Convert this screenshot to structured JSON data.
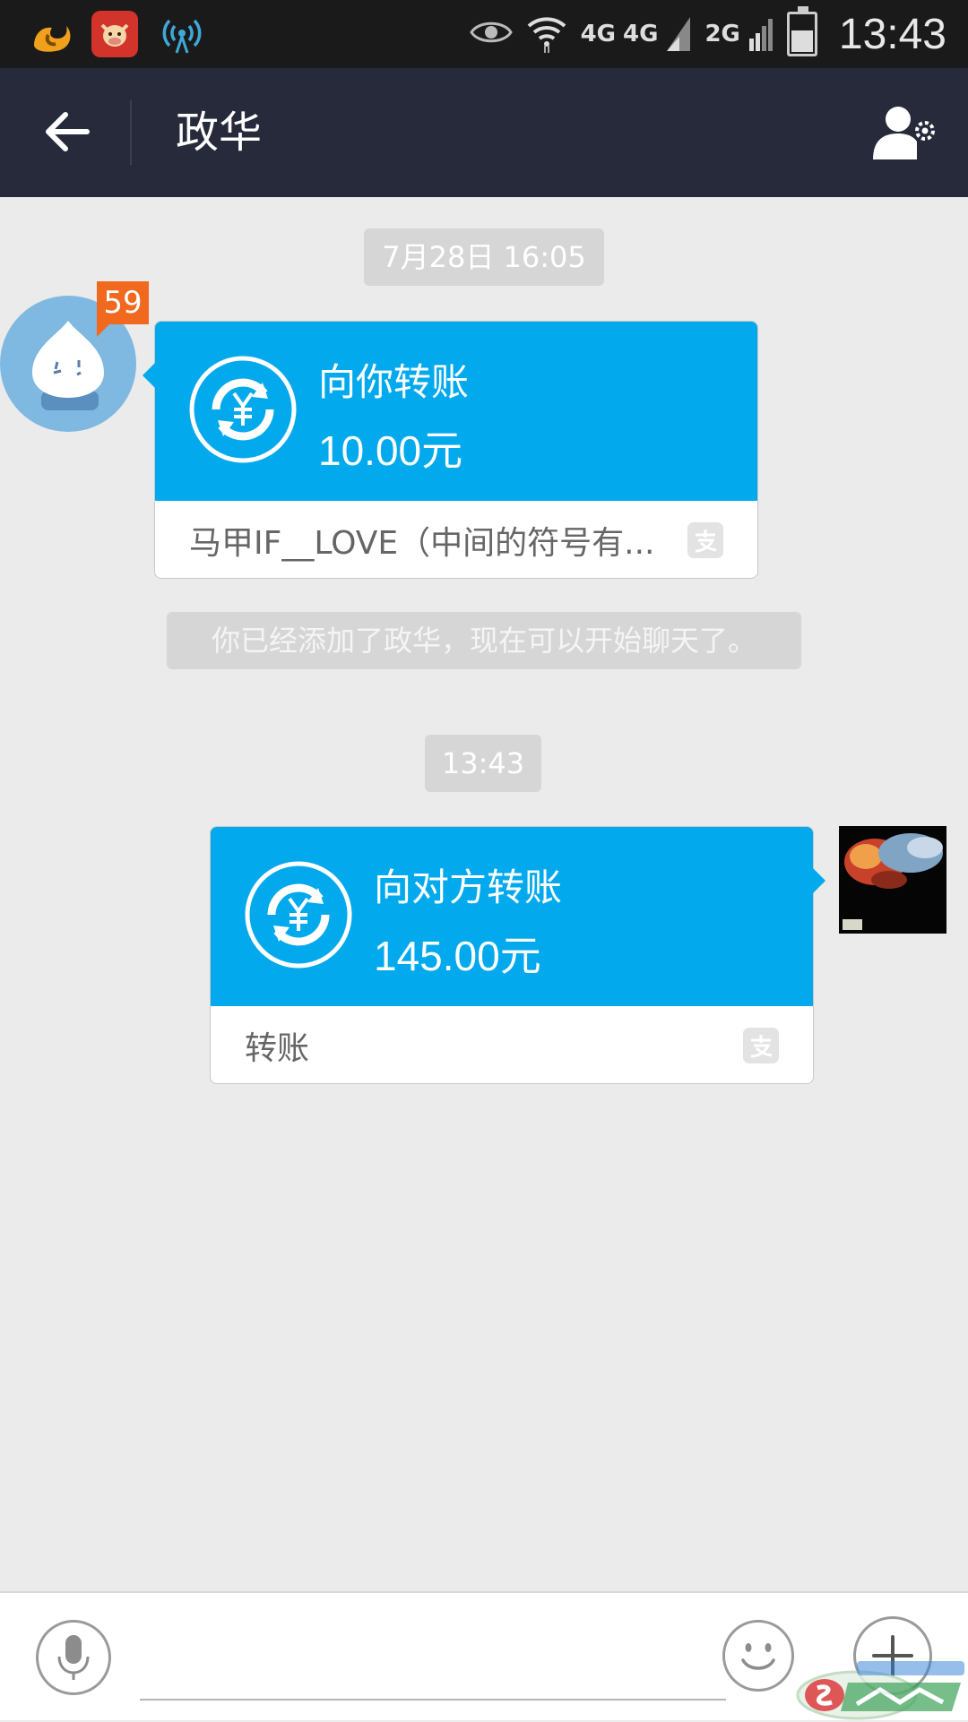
{
  "status_bar": {
    "network_labels": [
      "4G",
      "4G",
      "2G"
    ],
    "time": "13:43",
    "icons": [
      "uc-browser-icon",
      "cow-app-icon",
      "signal-broadcast-icon",
      "eye-icon",
      "wifi-icon",
      "battery-icon"
    ]
  },
  "header": {
    "title": "政华"
  },
  "chat": {
    "timestamps": [
      "7月28日 16:05",
      "13:43"
    ],
    "unread_badge": "59",
    "incoming_transfer": {
      "title": "向你转账",
      "amount": "10.00元",
      "note": "马甲IF__LOVE（中间的符号有..."
    },
    "system_notice": "你已经添加了政华，现在可以开始聊天了。",
    "outgoing_transfer": {
      "title": "向对方转账",
      "amount": "145.00元",
      "note": "转账"
    }
  },
  "input_bar": {
    "placeholder": ""
  },
  "colors": {
    "header_bg": "#262a3a",
    "card_blue": "#02a9ec",
    "badge_orange": "#f0691e",
    "chat_bg": "#ebebeb"
  }
}
